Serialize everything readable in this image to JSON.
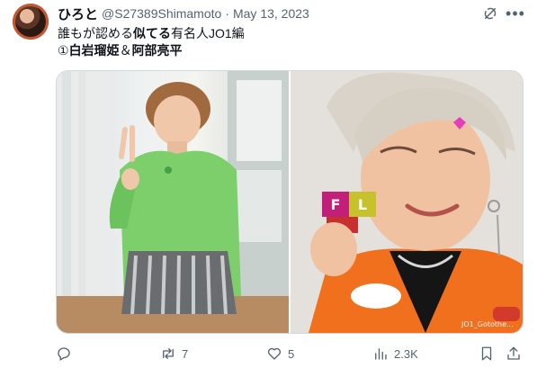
{
  "post": {
    "display_name": "ひろと",
    "handle": "@S27389Shimamoto",
    "separator": "·",
    "date": "May 13, 2023",
    "line1_prefix": "誰もが認める",
    "line1_bold": "似てる",
    "line1_suffix": "有名人JO1編",
    "line2_prefix": "①",
    "line2_bold1": "白岩瑠姫",
    "line2_mid": "＆",
    "line2_bold2": "阿部亮平"
  },
  "media": {
    "left_image": "man-in-green-hakama-peace-sign",
    "right_image": "blonde-man-holding-letter-blocks",
    "blocks_text_1": "F",
    "blocks_text_2": "L",
    "watermark": "JO1_Gotothe..."
  },
  "actions": {
    "reply_count": "",
    "retweet_count": "7",
    "like_count": "5",
    "views_count": "2.3K"
  },
  "colors": {
    "text": "#0f1419",
    "secondary": "#536471",
    "border": "#cfd9de",
    "green_kimono": "#7ccf6a",
    "orange_jacket": "#f0701e"
  }
}
